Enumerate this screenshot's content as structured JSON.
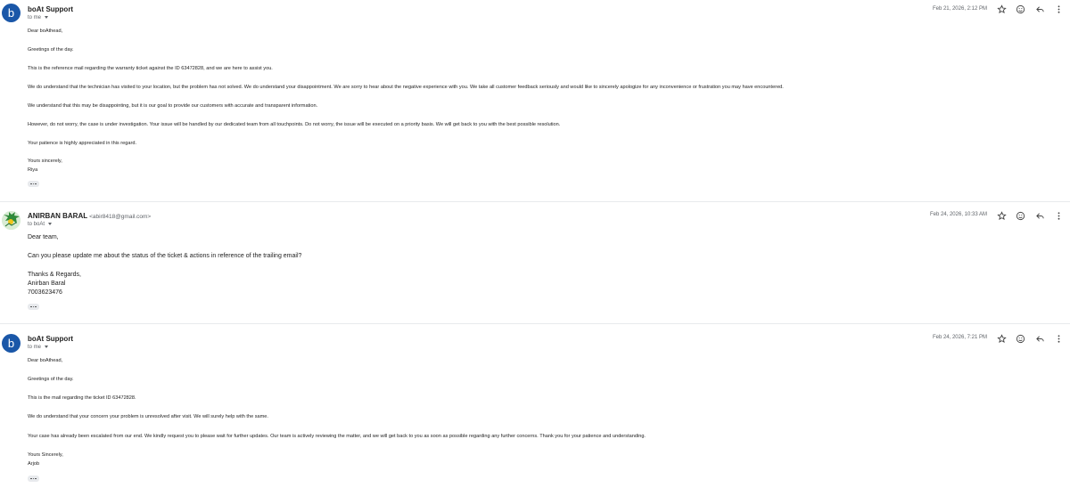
{
  "messages": [
    {
      "sender": "boAt Support",
      "email": "",
      "avatar_letter": "b",
      "recipient": "to me",
      "date": "Feb 21, 2026, 2:12 PM",
      "lines": [
        "Dear boAthead,",
        "Greetings of the day.",
        "This is the reference mail regarding the warranty ticket against the ID 63472828, and we are here to assist you.",
        "We do understand that the technician has visited to your location, but the problem has not solved. We do understand your disappointment. We are sorry to hear about the negative experience with you. We take all customer feedback seriously and would like to sincerely apologize for any inconvenience or frustration you may have encountered.",
        "We understand that this may be disappointing, but it is our goal to provide our customers with accurate and transparent information.",
        "However, do not worry, the case is under investigation. Your issue will be handled by our dedicated team from all touchpoints. Do not worry, the issue will be executed on a priority basis. We will get back to you with the best possible resolution.",
        "Your patience is highly appreciated in this regard.",
        "Yours sincerely,",
        "Riya"
      ]
    },
    {
      "sender": "ANIRBAN BARAL",
      "email": "<abir8418@gmail.com>",
      "avatar_letter": "",
      "recipient": "to boAt",
      "date": "Feb 24, 2026, 10:33 AM",
      "lines": [
        "Dear team,",
        "Can you please update me about the status of the ticket & actions in reference of the trailing email?",
        "Thanks & Regards,",
        "Anirban Baral",
        "7003623476"
      ]
    },
    {
      "sender": "boAt Support",
      "email": "",
      "avatar_letter": "b",
      "recipient": "to me",
      "date": "Feb 24, 2026, 7:21 PM",
      "lines": [
        "Dear boAthead,",
        "Greetings of the day.",
        "This is the mail regarding the ticket ID 63472828.",
        "We do understand that your concern your problem is unresolved after visit. We will surely help with the same.",
        "Your case has already been escalated from our end. We kindly request you to please wait for further updates. Our team is actively reviewing the matter, and we will get back to you as soon as possible regarding any further concerns. Thank you for your patience and understanding.",
        "Yours Sincerely,",
        "Arjob"
      ]
    }
  ],
  "icons": {
    "star": "star-icon",
    "emoji": "emoji-icon",
    "reply": "reply-icon",
    "more": "more-vert-icon"
  },
  "colors": {
    "avatar_bg": "#1a57a8"
  }
}
